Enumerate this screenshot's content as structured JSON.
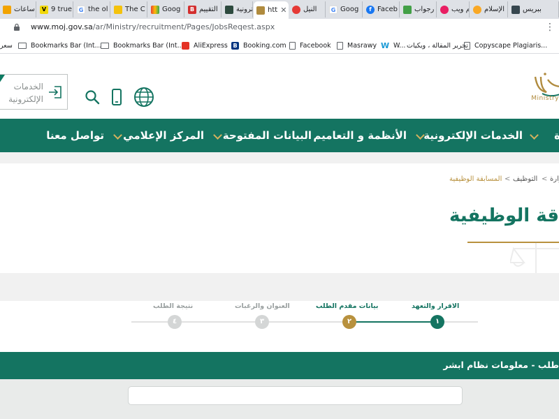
{
  "browser": {
    "tabs": [
      {
        "label": "ساعات \"",
        "favicon_color": "#f2a300",
        "favicon_char": ""
      },
      {
        "label": "9 true",
        "favicon_color": "#f1d80a",
        "favicon_char": "V"
      },
      {
        "label": "the ol",
        "favicon_color": "#4285f4",
        "favicon_char": "G"
      },
      {
        "label": "The C",
        "favicon_color": "#f4c20d",
        "favicon_char": ""
      },
      {
        "label": "Goog",
        "favicon_color": "#ea4335",
        "favicon_char": ""
      },
      {
        "label": "التقييم",
        "favicon_color": "#d32f2f",
        "favicon_char": "B"
      },
      {
        "label": "الكترونية",
        "favicon_color": "#2d4a3e",
        "favicon_char": ""
      },
      {
        "label": "htt",
        "favicon_color": "#b08b3e",
        "favicon_char": ""
      },
      {
        "label": "النيل",
        "favicon_color": "#e53935",
        "favicon_char": ""
      },
      {
        "label": "Goog",
        "favicon_color": "#4285f4",
        "favicon_char": "G"
      },
      {
        "label": "Faceb",
        "favicon_color": "#1877f2",
        "favicon_char": "f"
      },
      {
        "label": "رجواب",
        "favicon_color": "#43a047",
        "favicon_char": ""
      },
      {
        "label": "الم ويب",
        "favicon_color": "#e91e63",
        "favicon_char": ""
      },
      {
        "label": "الإسلام",
        "favicon_color": "#f9a825",
        "favicon_char": ""
      },
      {
        "label": "ببريس",
        "favicon_color": "#37474f",
        "favicon_char": ""
      }
    ],
    "url_host": "www.moj.gov.sa",
    "url_path": "/ar/Ministry/recruitment/Pages/JobsReqest.aspx",
    "menu_icon": "kebab-menu-icon",
    "bookmarks": [
      {
        "label": "سعر",
        "icon": "partial"
      },
      {
        "label": "Bookmarks Bar (Int...",
        "icon": "folder-icon"
      },
      {
        "label": "Bookmarks Bar (Int...",
        "icon": "folder-icon"
      },
      {
        "label": "AliExpress",
        "icon": "aliexpress-icon",
        "color": "#e43225"
      },
      {
        "label": "Booking.com",
        "icon": "booking-icon",
        "color": "#003580"
      },
      {
        "label": "Facebook",
        "icon": "page-icon"
      },
      {
        "label": "Masrawy",
        "icon": "page-icon"
      },
      {
        "label": "W...",
        "icon": "w-icon",
        "color": "#1a9ad6"
      },
      {
        "label": "تحرير المقالة ، ويكيات",
        "icon": "none"
      },
      {
        "label": "Copyscape Plagiaris...",
        "icon": "page-icon"
      }
    ]
  },
  "header": {
    "eservices_label_line1": "الخدمات",
    "eservices_label_line2": "الإلكترونية",
    "logo_caption": "Ministry",
    "colors": {
      "primary": "#147461",
      "accent": "#b8913e"
    }
  },
  "nav": {
    "items": [
      {
        "label": "ة",
        "has_dropdown": true
      },
      {
        "label": "الخدمات الإلكترونية",
        "has_dropdown": true
      },
      {
        "label": "الأنظمة و التعاميم",
        "has_dropdown": true
      },
      {
        "label": "البيانات المفتوحة",
        "has_dropdown": false
      },
      {
        "label": "المركز الإعلامي",
        "has_dropdown": true
      },
      {
        "label": "تواصل معنا",
        "has_dropdown": true
      }
    ]
  },
  "breadcrumb": {
    "items": [
      "زارة",
      "التوظيف",
      "المسابقة الوظيفية"
    ],
    "separator": "<"
  },
  "page_title": "قة الوظيفية",
  "stepper": {
    "steps": [
      {
        "number": "١",
        "label": "الاقرار والتعهد",
        "state": "active"
      },
      {
        "number": "٢",
        "label": "بيانات مقدم الطلب",
        "state": "next"
      },
      {
        "number": "٣",
        "label": "العنوان والرغبات",
        "state": "pending"
      },
      {
        "number": "٤",
        "label": "نتيجة الطلب",
        "state": "pending"
      }
    ]
  },
  "section": {
    "title": "طلب - معلومات نظام ابشر"
  }
}
